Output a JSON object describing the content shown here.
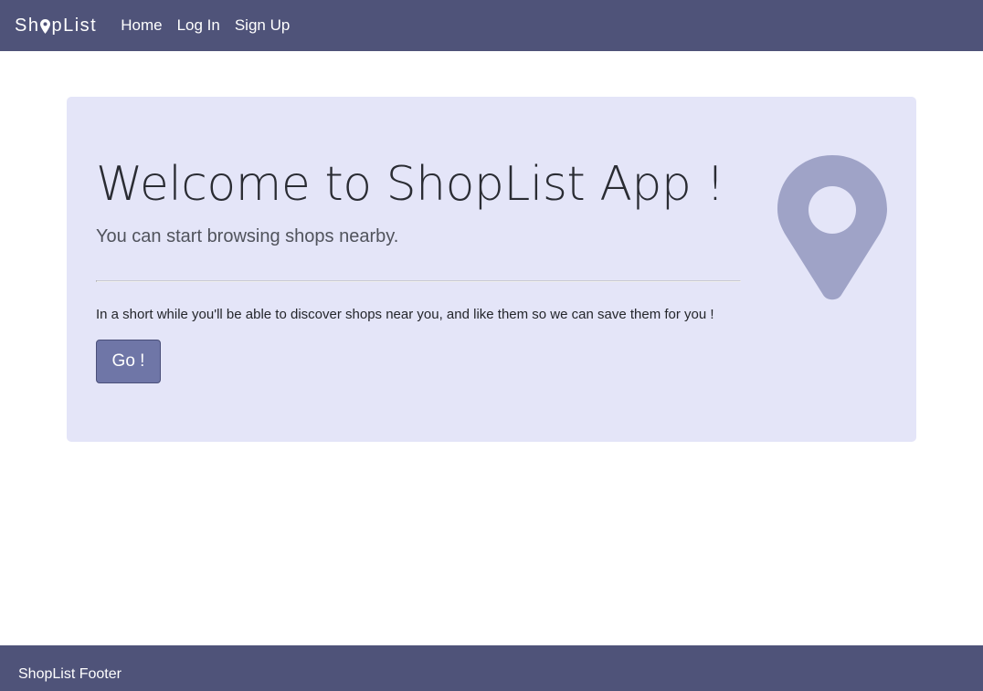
{
  "navbar": {
    "brand_prefix": "Sh",
    "brand_suffix": "pList",
    "brand_icon": "map-pin-icon",
    "links": [
      "Home",
      "Log In",
      "Sign Up"
    ]
  },
  "jumbotron": {
    "title": "Welcome to ShopList App !",
    "lead": "You can start browsing shops nearby.",
    "text": "In a short while you'll be able to discover shops near you, and like them so we can save them for you !",
    "button_label": "Go !",
    "icon": "map-marker-icon"
  },
  "footer": {
    "text": "ShopList Footer"
  },
  "colors": {
    "navbar": "#4f5379",
    "jumbotron_bg": "#e4e5f8",
    "button": "#6f76a7",
    "pin": "#9fa3c7"
  }
}
